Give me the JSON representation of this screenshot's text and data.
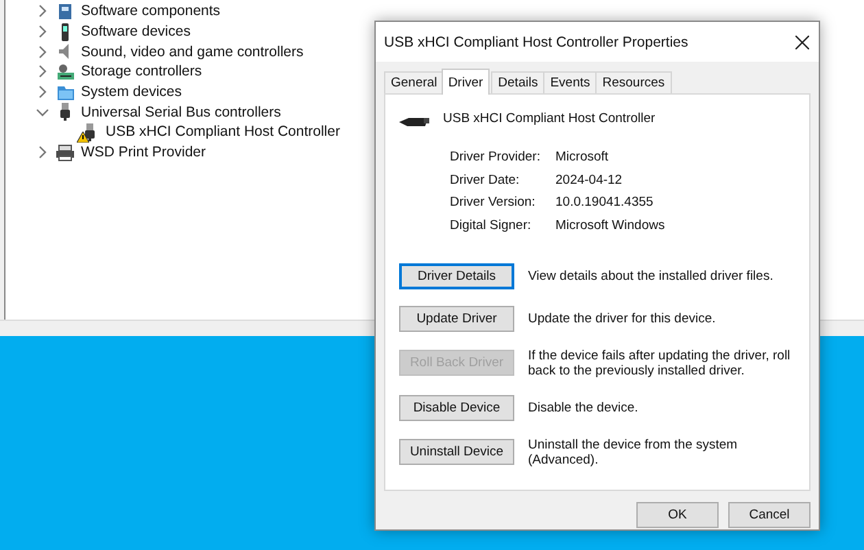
{
  "device_tree": [
    {
      "label": "Software components",
      "kind": "component",
      "expanded": false
    },
    {
      "label": "Software devices",
      "kind": "device",
      "expanded": false
    },
    {
      "label": "Sound, video and game controllers",
      "kind": "speaker",
      "expanded": false
    },
    {
      "label": "Storage controllers",
      "kind": "storage",
      "expanded": false
    },
    {
      "label": "System devices",
      "kind": "folder",
      "expanded": false
    },
    {
      "label": "Universal Serial Bus controllers",
      "kind": "usb",
      "expanded": true,
      "children": [
        {
          "label": "USB xHCI Compliant Host Controller",
          "kind": "usb",
          "warning": true
        }
      ]
    },
    {
      "label": "WSD Print Provider",
      "kind": "printer",
      "expanded": false
    }
  ],
  "dialog": {
    "title": "USB xHCI Compliant Host Controller Properties",
    "tabs": [
      {
        "label": "General",
        "selected": false
      },
      {
        "label": "Driver",
        "selected": true
      },
      {
        "label": "Details",
        "selected": false
      },
      {
        "label": "Events",
        "selected": false
      },
      {
        "label": "Resources",
        "selected": false
      }
    ],
    "device_name": "USB xHCI Compliant Host Controller",
    "properties": [
      {
        "label": "Driver Provider:",
        "value": "Microsoft"
      },
      {
        "label": "Driver Date:",
        "value": "2024-04-12"
      },
      {
        "label": "Driver Version:",
        "value": "10.0.19041.4355"
      },
      {
        "label": "Digital Signer:",
        "value": "Microsoft Windows"
      }
    ],
    "actions": [
      {
        "button": "Driver Details",
        "description": "View details about the installed driver files.",
        "disabled": false,
        "focused": true
      },
      {
        "button": "Update Driver",
        "description": "Update the driver for this device.",
        "disabled": false,
        "focused": false
      },
      {
        "button": "Roll Back Driver",
        "description": "If the device fails after updating the driver, roll back to the previously installed driver.",
        "disabled": true,
        "focused": false
      },
      {
        "button": "Disable Device",
        "description": "Disable the device.",
        "disabled": false,
        "focused": false
      },
      {
        "button": "Uninstall Device",
        "description": "Uninstall the device from the system (Advanced).",
        "disabled": false,
        "focused": false
      }
    ],
    "buttons": [
      "OK",
      "Cancel"
    ]
  }
}
